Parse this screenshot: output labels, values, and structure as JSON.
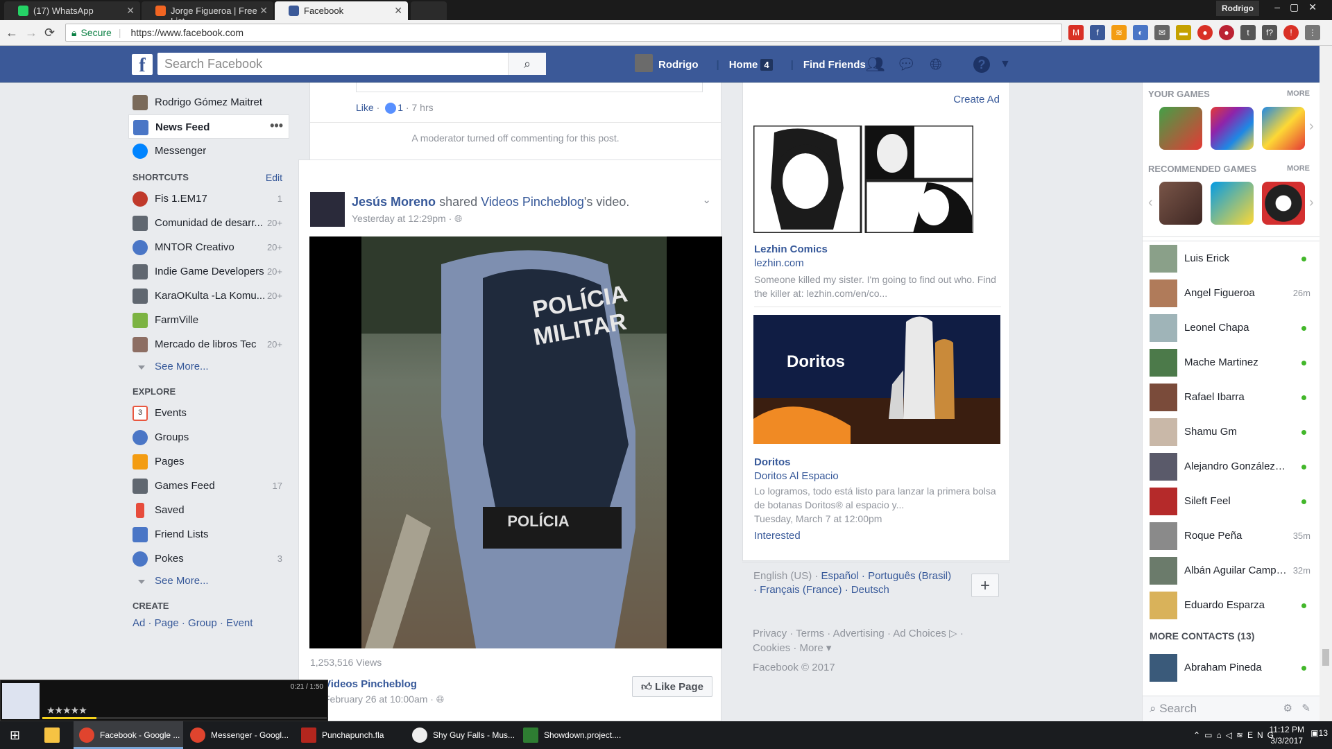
{
  "browser": {
    "tabs": [
      {
        "title": "(17) WhatsApp",
        "color": "#25d366"
      },
      {
        "title": "Jorge Figueroa | Free List",
        "color": "#f26522"
      },
      {
        "title": "Facebook",
        "color": "#3b5998"
      }
    ],
    "window_user": "Rodrigo",
    "secure_label": "Secure",
    "url": "https://www.facebook.com"
  },
  "header": {
    "logo": "f",
    "search_placeholder": "Search Facebook",
    "user_name": "Rodrigo",
    "home_label": "Home",
    "home_count": "4",
    "find_friends": "Find Friends"
  },
  "leftnav": {
    "profile_name": "Rodrigo Gómez Maitret",
    "news_feed": "News Feed",
    "messenger": "Messenger",
    "shortcuts_title": "SHORTCUTS",
    "edit_label": "Edit",
    "shortcuts": [
      {
        "label": "Fis 1.EM17",
        "count": "1",
        "color": "#c0392b"
      },
      {
        "label": "Comunidad de desarr...",
        "count": "20+",
        "color": "#606770"
      },
      {
        "label": "MNTOR Creativo",
        "count": "20+",
        "color": "#4a76c6"
      },
      {
        "label": "Indie Game Developers",
        "count": "20+",
        "color": "#606770"
      },
      {
        "label": "KaraOKulta -La Komu...",
        "count": "20+",
        "color": "#606770"
      },
      {
        "label": "FarmVille",
        "count": "",
        "color": "#7cb342"
      },
      {
        "label": "Mercado de libros Tec",
        "count": "20+",
        "color": "#8d6e63"
      }
    ],
    "see_more": "See More...",
    "explore_title": "EXPLORE",
    "explore": [
      {
        "label": "Events",
        "count": "",
        "color": "#e9573f"
      },
      {
        "label": "Groups",
        "count": "",
        "color": "#4a76c6"
      },
      {
        "label": "Pages",
        "count": "",
        "color": "#f39c12"
      },
      {
        "label": "Games Feed",
        "count": "17",
        "color": "#606770"
      },
      {
        "label": "Saved",
        "count": "",
        "color": "#e74c3c"
      },
      {
        "label": "Friend Lists",
        "count": "",
        "color": "#4a76c6"
      },
      {
        "label": "Pokes",
        "count": "3",
        "color": "#4a76c6"
      }
    ],
    "see_more_2": "See More...",
    "create_title": "CREATE",
    "create_links": "Ad · Page · Group · Event"
  },
  "feed": {
    "prev_post": {
      "like_label": "Like",
      "like_count": "1",
      "time": "7 hrs",
      "moderator_note": "A moderator turned off commenting for this post."
    },
    "post": {
      "author": "Jesús Moreno",
      "shared_text": "shared",
      "page_name": "Videos Pincheblog",
      "shared_suffix": "'s video.",
      "time": "Yesterday at 12:29pm ·",
      "views": "1,253,516 Views",
      "video_page": "Videos Pincheblog",
      "video_date": "February 26 at 10:00am ·",
      "like_page": "Like Page",
      "video_text_1": "POLÍCIA",
      "video_text_2": "MILITAR",
      "video_text_3": "POLÍCIA"
    }
  },
  "ads": {
    "create_ad": "Create Ad",
    "ad1": {
      "title": "Lezhin Comics",
      "domain": "lezhin.com",
      "text": "Someone killed my sister. I'm going to find out who. Find the killer at: lezhin.com/en/co..."
    },
    "ad2": {
      "brand_text": "Doritos",
      "title": "Doritos",
      "subtitle": "Doritos Al Espacio",
      "text": "Lo logramos, todo está listo para lanzar la primera bolsa de botanas Doritos® al espacio y...",
      "date": "Tuesday, March 7 at 12:00pm",
      "action": "Interested"
    },
    "languages_current": "English (US) ·",
    "languages": "Español · Português (Brasil) · Français (France) · Deutsch",
    "footer_links": "Privacy · Terms · Advertising · Ad Choices ▷ · Cookies · More ▾",
    "copyright": "Facebook © 2017"
  },
  "rightbar": {
    "your_games": "YOUR GAMES",
    "more": "MORE",
    "recommended_games": "RECOMMENDED GAMES",
    "games": [
      "#e53935",
      "#8e24aa",
      "#fdd835"
    ],
    "rec_games": [
      "#5d4037",
      "#039be5",
      "#212121"
    ],
    "contacts": [
      {
        "name": "Luis Erick",
        "status": "online",
        "ago": ""
      },
      {
        "name": "Angel Figueroa",
        "status": "away",
        "ago": "26m"
      },
      {
        "name": "Leonel Chapa",
        "status": "online",
        "ago": ""
      },
      {
        "name": "Mache Martinez",
        "status": "online",
        "ago": ""
      },
      {
        "name": "Rafael Ibarra",
        "status": "online",
        "ago": ""
      },
      {
        "name": "Shamu Gm",
        "status": "online",
        "ago": ""
      },
      {
        "name": "Alejandro González Va...",
        "status": "online",
        "ago": ""
      },
      {
        "name": "Sileft Feel",
        "status": "online",
        "ago": ""
      },
      {
        "name": "Roque Peña",
        "status": "away",
        "ago": "35m"
      },
      {
        "name": "Albán Aguilar Campos",
        "status": "away",
        "ago": "32m"
      },
      {
        "name": "Eduardo Esparza",
        "status": "online",
        "ago": ""
      }
    ],
    "more_contacts": "MORE CONTACTS (13)",
    "extra_contact": "Abraham Pineda",
    "search_placeholder": "Search"
  },
  "player": {
    "time": "0:21 / 1:50",
    "progress": 0.19,
    "rating": "★★★★★"
  },
  "taskbar": {
    "items": [
      "Facebook - Google ...",
      "Messenger - Googl...",
      "Punchapunch.fla",
      "Shy Guy Falls - Mus...",
      "Showdown.project...."
    ],
    "lang": "ENG",
    "time": "11:12 PM",
    "date": "3/3/2017",
    "notif_count": "13"
  },
  "colors": {
    "fb_blue": "#3b5998",
    "link": "#365899",
    "online": "#42b72a"
  }
}
